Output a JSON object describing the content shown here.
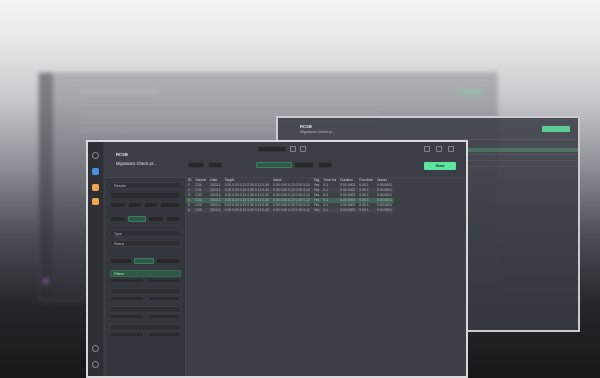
{
  "colors": {
    "accent": "#5fe3a1",
    "window_bg": "#3a3d44",
    "sidebar_bg": "#34373d",
    "rail_bg": "#2e3036",
    "highlight_row": "#2f6b51",
    "orange_icon": "#f0a64a",
    "blue_icon": "#4a8fe0",
    "purple_icon": "#a77be0"
  },
  "app": {
    "name": "RCSB",
    "subtitle": "Migrations Check pr...",
    "new_button": "Start"
  },
  "window2": {
    "name": "RCSB",
    "subtitle": "Migrations Check pr..."
  },
  "sidebar": {
    "section_filter": "Results",
    "section_type": "Type",
    "section_type2": "Status",
    "section_expand": "Filters"
  },
  "table": {
    "headers": [
      "ID",
      "Source",
      "Date",
      "Target",
      "Value",
      "Tag",
      "Time ms",
      "Duration",
      "Run time",
      "Owner"
    ],
    "rows": [
      [
        "1",
        "C01",
        "2023-1",
        "0.20 0.20 0.21 0.30 0.12 0.30",
        "0.00 0.00 0.22 0.20 0.12",
        "Yes",
        "0.1",
        "0.00.0002",
        "0.00.1",
        "0.00.0001"
      ],
      [
        "2",
        "C01",
        "2023-1",
        "0.20 0.20 0.21 0.30 0.12 0.30",
        "0.00 0.00 0.22 0.20 0.12",
        "Yes",
        "0.1",
        "0.00.0002",
        "0.00.1",
        "0.00.0001"
      ],
      [
        "3",
        "C02",
        "2023-1",
        "0.20 0.20 0.21 0.30 0.12 0.30",
        "0.00 0.00 0.22 0.20 0.12",
        "Yes",
        "0.1",
        "0.00.0002",
        "0.00.1",
        "0.00.0001"
      ],
      [
        "4",
        "C02",
        "2023-1",
        "0.20 0.20 0.21 0.30 0.12 0.30",
        "0.00 0.00 0.22 0.20 0.12",
        "Yes",
        "0.1",
        "0.00.0002",
        "0.00.1",
        "0.00.0001"
      ],
      [
        "5",
        "C03",
        "2023-1",
        "0.20 0.20 0.21 0.30 0.12 0.30",
        "0.00 0.00 0.22 0.20 0.12",
        "Yes",
        "0.1",
        "0.00.0002",
        "0.00.1",
        "0.00.0001"
      ],
      [
        "6",
        "C03",
        "2023-1",
        "0.20 0.20 0.21 0.30 0.12 0.30",
        "0.00 0.00 0.22 0.20 0.12",
        "Yes",
        "0.1",
        "0.00.0002",
        "0.00.1",
        "0.00.0001"
      ]
    ],
    "selected_row": 3
  }
}
